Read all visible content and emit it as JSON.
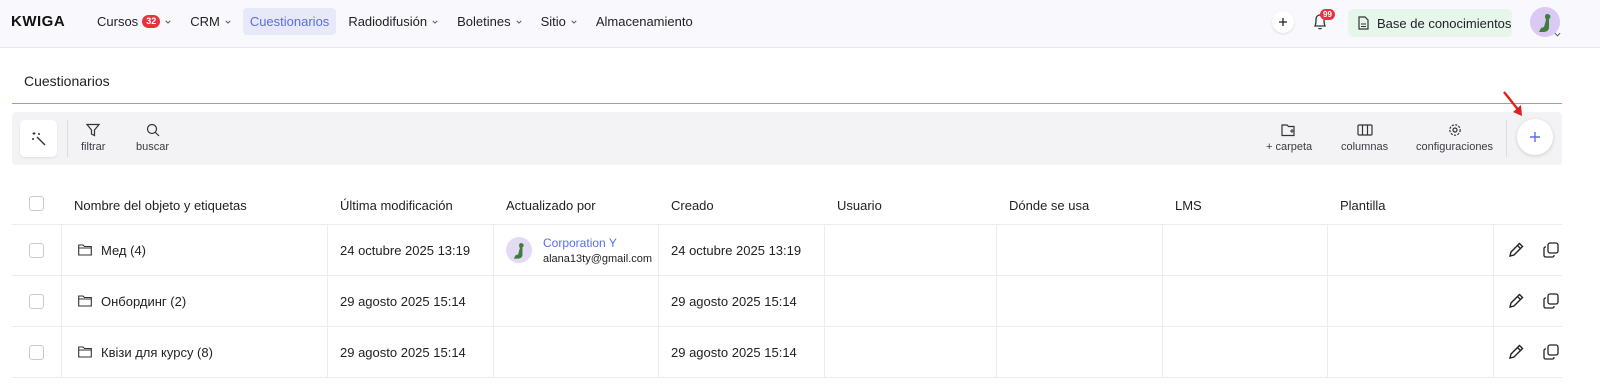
{
  "brand": "KWIGA",
  "nav": {
    "items": [
      {
        "label": "Cursos",
        "badge": "32",
        "dropdown": true
      },
      {
        "label": "CRM",
        "dropdown": true
      },
      {
        "label": "Cuestionarios",
        "active": true
      },
      {
        "label": "Radiodifusión",
        "dropdown": true
      },
      {
        "label": "Boletines",
        "dropdown": true
      },
      {
        "label": "Sitio",
        "dropdown": true
      },
      {
        "label": "Almacenamiento"
      }
    ],
    "notifications_count": "99",
    "knowledge_base_label": "Base de conocimientos"
  },
  "page": {
    "title": "Cuestionarios"
  },
  "toolbar": {
    "filter_label": "filtrar",
    "search_label": "buscar",
    "folder_label": "+ carpeta",
    "columns_label": "columnas",
    "settings_label": "configuraciones"
  },
  "table": {
    "columns": [
      "Nombre del objeto y etiquetas",
      "Última modificación",
      "Actualizado por",
      "Creado",
      "Usuario",
      "Dónde se usa",
      "LMS",
      "Plantilla"
    ],
    "rows": [
      {
        "name": "Мед (4)",
        "modified": "24 octubre 2025 13:19",
        "updated_by_name": "Corporation Y",
        "updated_by_email": "alana13ty@gmail.com",
        "created": "24 octubre 2025 13:19"
      },
      {
        "name": "Онбординг (2)",
        "modified": "29 agosto 2025 15:14",
        "updated_by_name": "",
        "updated_by_email": "",
        "created": "29 agosto 2025 15:14"
      },
      {
        "name": "Квізи для курсу (8)",
        "modified": "29 agosto 2025 15:14",
        "updated_by_name": "",
        "updated_by_email": "",
        "created": "29 agosto 2025 15:14"
      }
    ]
  },
  "colors": {
    "accent": "#5b6ee8",
    "badge": "#e8323c",
    "kb_bg": "#e7f6ea",
    "arrow": "#e02020"
  }
}
